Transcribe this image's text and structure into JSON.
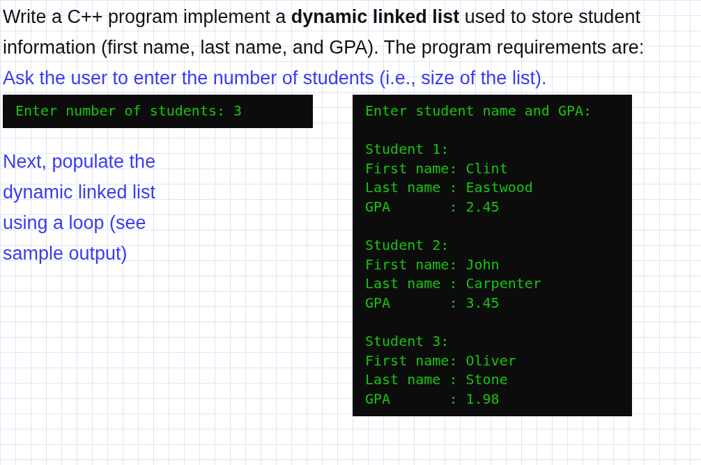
{
  "intro": "Write a C++ program implement a **dynamic linked list** used to store student information (first name, last name, and GPA). The program requirements are:",
  "step_1": "Ask the user to enter the number of students (i.e., size of the list).",
  "console_1": {
    "blocks": [
      [
        "Enter number of students: 3"
      ]
    ]
  },
  "step_2": "Next, populate the dynamic linked list using a loop (see sample output)",
  "console_2": {
    "blocks": [
      [
        "Enter student name and GPA:"
      ],
      [
        "Student 1:",
        "First name: Clint",
        "Last name : Eastwood",
        "GPA       : 2.45"
      ],
      [
        "Student 2:",
        "First name: John",
        "Last name : Carpenter",
        "GPA       : 3.45"
      ],
      [
        "Student 3:",
        "First name: Oliver",
        "Last name : Stone",
        "GPA       : 1.98"
      ]
    ]
  }
}
